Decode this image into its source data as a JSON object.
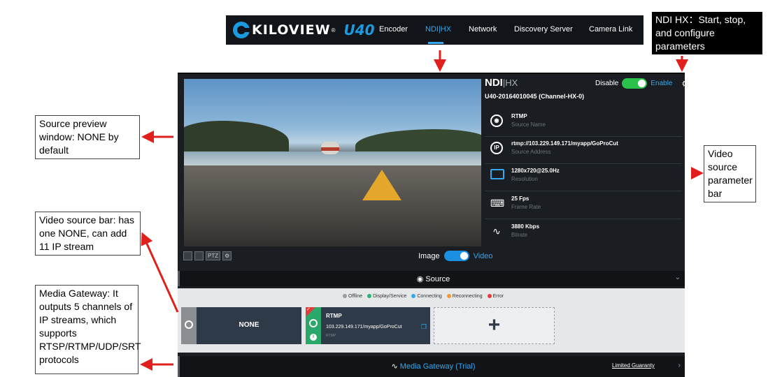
{
  "nav": {
    "logo_text": "KILOVIEW",
    "logo_reg": "®",
    "logo_model": "U40",
    "tabs": [
      {
        "label": "Encoder"
      },
      {
        "label": "NDI|HX"
      },
      {
        "label": "Network"
      },
      {
        "label": "Discovery Server"
      },
      {
        "label": "Camera Link"
      }
    ],
    "active_tab": "NDI|HX"
  },
  "preview": {
    "tools": [
      "",
      "",
      "PTZ",
      "⚙"
    ],
    "mode": {
      "left_label": "Image",
      "right_label": "Video",
      "value": "Video"
    }
  },
  "ndi": {
    "logo_main": "NDI",
    "logo_sub": "HX",
    "device_name": "U40-20164010045 (Channel-HX-0)",
    "disable_label": "Disable",
    "enable_label": "Enable",
    "enabled": true,
    "params": [
      {
        "icon": "source-name-icon",
        "value": "RTMP",
        "label": "Source Name"
      },
      {
        "icon": "ip-icon",
        "value": "rtmp://103.229.149.171/myapp/GoProCut",
        "label": "Source Address"
      },
      {
        "icon": "monitor-icon",
        "value": "1280x720@25.0Hz",
        "label": "Resolution"
      },
      {
        "icon": "frame-rate-icon",
        "value": "25 Fps",
        "label": "Frame Rate"
      },
      {
        "icon": "pulse-icon",
        "value": "3880 Kbps",
        "label": "Bitrate"
      }
    ]
  },
  "source": {
    "title": "Source",
    "legend": [
      {
        "label": "Offline",
        "color": "#9a9ea3"
      },
      {
        "label": "Display/Service",
        "color": "#2bb673"
      },
      {
        "label": "Connecting",
        "color": "#35a8f0"
      },
      {
        "label": "Reconnecting",
        "color": "#f29a2e"
      },
      {
        "label": "Error",
        "color": "#e23b3b"
      }
    ],
    "cards": [
      {
        "name": "NONE"
      },
      {
        "name": "RTMP",
        "address": "103.229.149.171/myapp/GoProCut",
        "protocol": "RTMP"
      }
    ],
    "add_label": "+"
  },
  "gateway": {
    "title": "Media Gateway (Trial)",
    "link": "Limited Guaranty"
  },
  "annotations": {
    "ndi_hx": "NDI HX：Start, stop, and configure parameters",
    "preview": "Source preview window: NONE by default",
    "video_param": "Video source parameter bar",
    "video_bar": "Video source bar: has one NONE, can add 11 IP stream",
    "media_gw": "Media Gateway: It outputs 5 channels of IP streams, which supports RTSP/RTMP/UDP/SRT protocols"
  },
  "colors": {
    "accent": "#35a8f0",
    "arrow": "#e0201c",
    "enable_toggle": "#2bc24b"
  }
}
